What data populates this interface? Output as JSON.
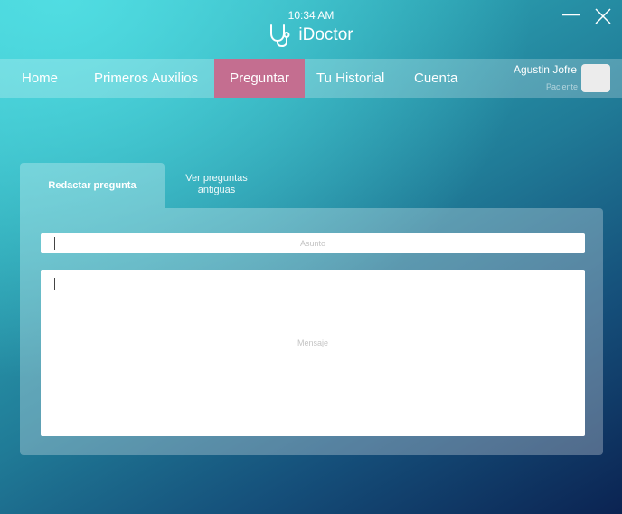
{
  "window": {
    "clock": "10:34 AM",
    "app_name": "iDoctor",
    "brand_icon": "stethoscope-icon",
    "minimize_icon": "minimize-icon",
    "close_icon": "close-icon"
  },
  "nav": {
    "items": [
      {
        "label": "Home"
      },
      {
        "label": "Primeros Auxilios"
      },
      {
        "label": "Preguntar",
        "active": true
      },
      {
        "label": "Tu Historial"
      },
      {
        "label": "Cuenta"
      }
    ],
    "active_color": "#c46e90"
  },
  "user": {
    "name": "Agustin Jofre",
    "role": "Paciente"
  },
  "tabs": [
    {
      "label": "Redactar pregunta",
      "active": true
    },
    {
      "label": "Ver preguntas antiguas"
    }
  ],
  "form": {
    "subject_placeholder": "Asunto",
    "subject_value": "",
    "message_placeholder": "Mensaje",
    "message_value": ""
  },
  "colors": {
    "bg_top": "#54e2e6",
    "bg_bottom": "#0b2352"
  }
}
